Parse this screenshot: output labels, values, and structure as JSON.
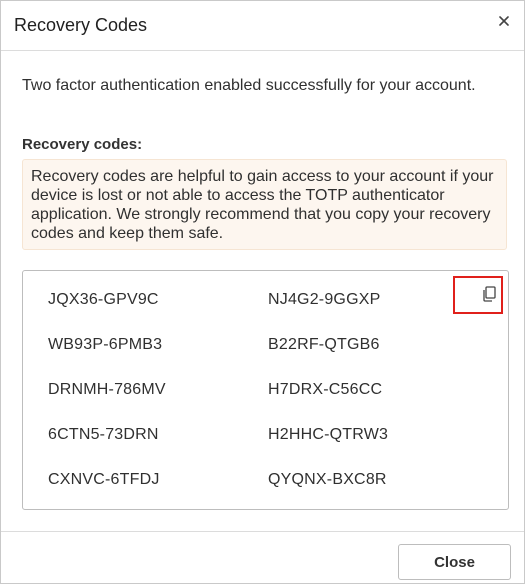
{
  "dialog": {
    "title": "Recovery Codes",
    "close_icon": "close-icon"
  },
  "body": {
    "message": "Two factor authentication enabled successfully for your account.",
    "codes_label": "Recovery codes:",
    "warning": "Recovery codes are helpful to gain access to your account if your device is lost or not able to access the TOTP authenticator application. We strongly recommend that you copy your recovery codes and keep them safe.",
    "warning_bg_color": "#fdf6ef",
    "copy_icon": "copy-icon",
    "copy_highlight_color": "#e0201b",
    "codes": [
      "JQX36-GPV9C",
      "NJ4G2-9GGXP",
      "WB93P-6PMB3",
      "B22RF-QTGB6",
      "DRNMH-786MV",
      "H7DRX-C56CC",
      "6CTN5-73DRN",
      "H2HHC-QTRW3",
      "CXNVC-6TFDJ",
      "QYQNX-BXC8R"
    ]
  },
  "footer": {
    "close_label": "Close"
  }
}
